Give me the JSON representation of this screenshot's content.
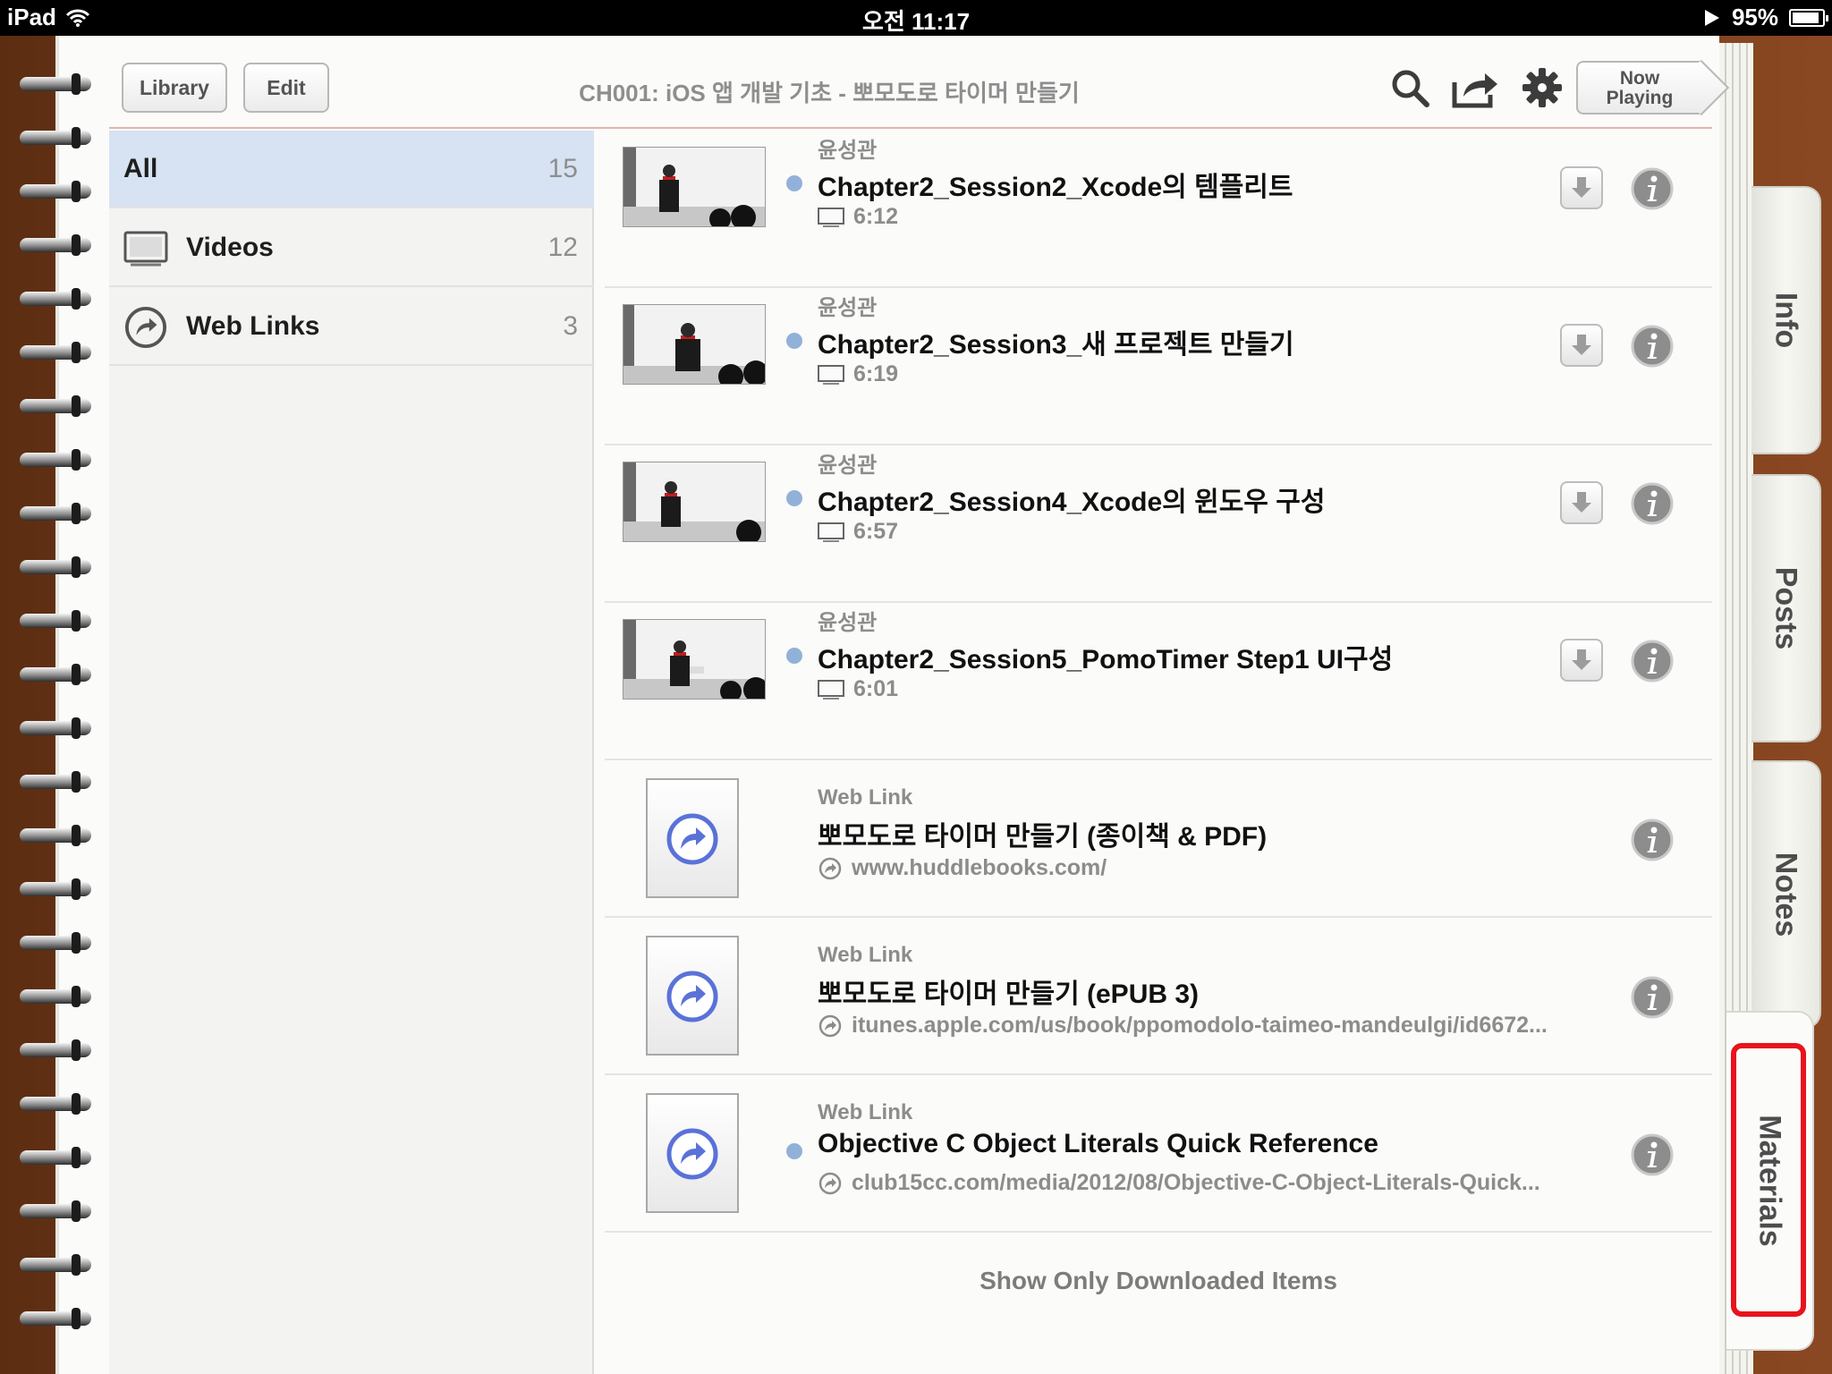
{
  "status_bar": {
    "device": "iPad",
    "time": "오전 11:17",
    "battery": "95%"
  },
  "toolbar": {
    "library_label": "Library",
    "edit_label": "Edit",
    "title": "CH001: iOS 앱 개발 기초 - 뽀모도로 타이머 만들기",
    "now_playing_line1": "Now",
    "now_playing_line2": "Playing"
  },
  "sidebar": {
    "items": [
      {
        "label": "All",
        "count": "15"
      },
      {
        "label": "Videos",
        "count": "12"
      },
      {
        "label": "Web Links",
        "count": "3"
      }
    ]
  },
  "items": [
    {
      "type": "video",
      "author": "윤성관",
      "title": "Chapter2_Session2_Xcode의 템플리트",
      "duration": "6:12"
    },
    {
      "type": "video",
      "author": "윤성관",
      "title": "Chapter2_Session3_새 프로젝트 만들기",
      "duration": "6:19"
    },
    {
      "type": "video",
      "author": "윤성관",
      "title": "Chapter2_Session4_Xcode의 윈도우 구성",
      "duration": "6:57"
    },
    {
      "type": "video",
      "author": "윤성관",
      "title": "Chapter2_Session5_PomoTimer Step1 UI구성",
      "duration": "6:01"
    },
    {
      "type": "link",
      "author": "Web Link",
      "title": "뽀모도로 타이머 만들기 (종이책 & PDF)",
      "url": "www.huddlebooks.com/"
    },
    {
      "type": "link",
      "author": "Web Link",
      "title": "뽀모도로 타이머 만들기 (ePUB 3)",
      "url": "itunes.apple.com/us/book/ppomodolo-taimeo-mandeulgi/id6672..."
    },
    {
      "type": "link",
      "author": "Web Link",
      "title": "Objective C Object Literals Quick Reference",
      "url": "club15cc.com/media/2012/08/Objective-C-Object-Literals-Quick..."
    }
  ],
  "footer": {
    "show_downloaded": "Show Only Downloaded Items"
  },
  "tabs": {
    "info": "Info",
    "posts": "Posts",
    "notes": "Notes",
    "materials": "Materials"
  },
  "colors": {
    "selection": "#d7e2f2",
    "unread_dot": "#92b1d9",
    "highlight": "#e8141c"
  }
}
